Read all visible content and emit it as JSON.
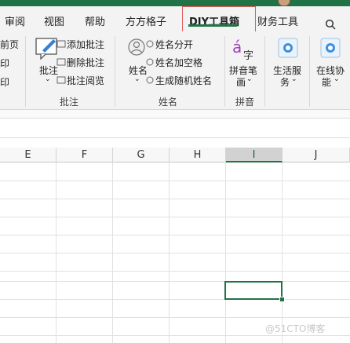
{
  "tabs": [
    "审阅",
    "视图",
    "帮助",
    "方方格子",
    "DIY工具箱",
    "财务工具"
  ],
  "active_tab": "DIY工具箱",
  "ribbon": {
    "left_cut": [
      "前页",
      "印",
      "印"
    ],
    "comment_group": {
      "big_button": "批注",
      "items": [
        "添加批注",
        "删除批注",
        "批注阅览"
      ],
      "label": "批注"
    },
    "name_group": {
      "big_button": "姓名",
      "items": [
        "姓名分开",
        "姓名加空格",
        "生成随机姓名"
      ],
      "label": "姓名"
    },
    "pinyin_group": {
      "big_button_lines": [
        "拼音笔",
        "画"
      ],
      "label": "拼音"
    },
    "life_service": [
      "生活服",
      "务"
    ],
    "online_tools": [
      "在线协",
      "能"
    ]
  },
  "columns": [
    "E",
    "F",
    "G",
    "H",
    "I",
    "J"
  ],
  "selected_column": "I",
  "watermark": "@51CTO博客",
  "colors": {
    "accent": "#217346",
    "highlight_box": "#e25b5b"
  }
}
